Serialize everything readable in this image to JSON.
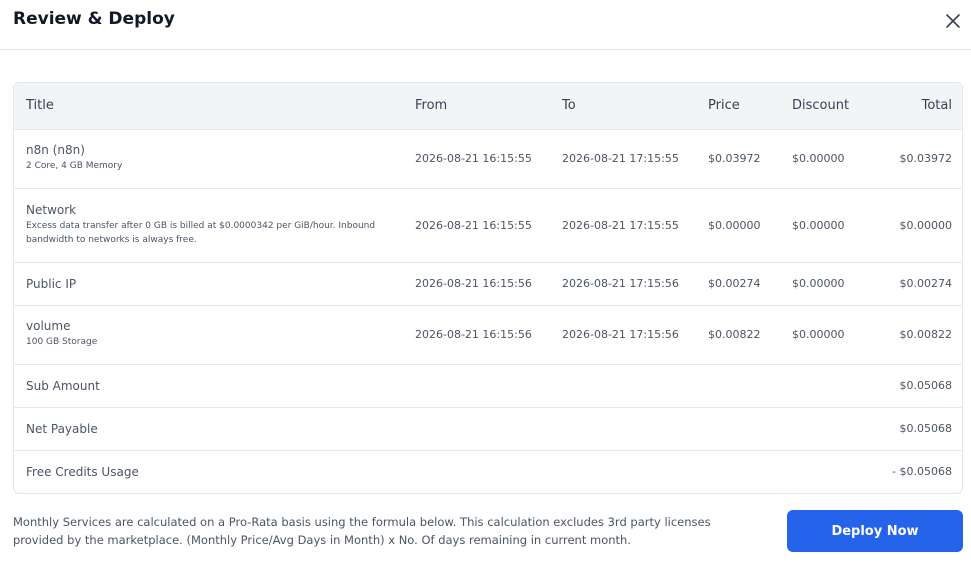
{
  "header": {
    "title": "Review & Deploy",
    "close_icon": "close-icon"
  },
  "table": {
    "columns": [
      "Title",
      "From",
      "To",
      "Price",
      "Discount",
      "Total"
    ],
    "rows": [
      {
        "title": "n8n (n8n)",
        "subtitle": "2 Core, 4 GB Memory",
        "from": "2026-08-21 16:15:55",
        "to": "2026-08-21 17:15:55",
        "price": "$0.03972",
        "discount": "$0.00000",
        "total": "$0.03972"
      },
      {
        "title": "Network",
        "subtitle": "Excess data transfer after 0 GB is billed at $0.0000342 per GiB/hour. Inbound bandwidth to networks is always free.",
        "from": "2026-08-21 16:15:55",
        "to": "2026-08-21 17:15:55",
        "price": "$0.00000",
        "discount": "$0.00000",
        "total": "$0.00000"
      },
      {
        "title": "Public IP",
        "subtitle": "",
        "from": "2026-08-21 16:15:56",
        "to": "2026-08-21 17:15:56",
        "price": "$0.00274",
        "discount": "$0.00000",
        "total": "$0.00274"
      },
      {
        "title": "volume",
        "subtitle": "100 GB Storage",
        "from": "2026-08-21 16:15:56",
        "to": "2026-08-21 17:15:56",
        "price": "$0.00822",
        "discount": "$0.00000",
        "total": "$0.00822"
      }
    ],
    "summary": [
      {
        "label": "Sub Amount",
        "value": "$0.05068"
      },
      {
        "label": "Net Payable",
        "value": "$0.05068"
      },
      {
        "label": "Free Credits Usage",
        "value": "- $0.05068"
      }
    ]
  },
  "footer": {
    "note": "Monthly Services are calculated on a Pro-Rata basis using the formula below. This calculation excludes 3rd party licenses provided by the marketplace. (Monthly Price/Avg Days in Month) x No. Of days remaining in current month.",
    "deploy_label": "Deploy Now"
  },
  "colors": {
    "accent": "#2563eb",
    "header_bg": "#f3f4f6",
    "border": "#e5e7eb"
  }
}
